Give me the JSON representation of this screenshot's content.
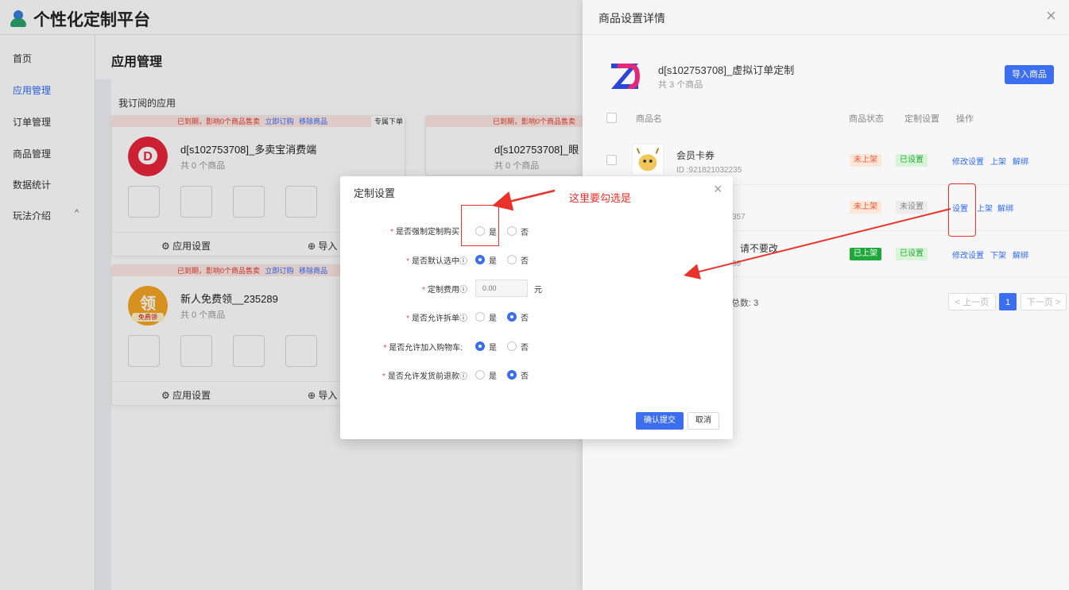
{
  "app": {
    "title": "个性化定制平台"
  },
  "sidebar": {
    "items": [
      {
        "label": "首页"
      },
      {
        "label": "应用管理"
      },
      {
        "label": "订单管理"
      },
      {
        "label": "商品管理"
      },
      {
        "label": "数据统计"
      },
      {
        "label": "玩法介绍"
      }
    ],
    "active": "应用管理"
  },
  "main": {
    "page_title": "应用管理",
    "section_title": "我订阅的应用",
    "banner": {
      "text": "已到期，影响0个商品售卖",
      "renew": "立即订购",
      "remove": "移除商品",
      "tag": "专属下单"
    },
    "cards": [
      {
        "name": "d[s102753708]_多卖宝消费端",
        "count": "共 0 个商品",
        "settings": "应用设置",
        "import": "导入"
      },
      {
        "name": "d[s102753708]_眼",
        "count": "共 0 个商品"
      },
      {
        "name": "新人免费领__235289",
        "count": "共 0 个商品",
        "settings": "应用设置",
        "import": "导入",
        "logo_text": "领",
        "logo_sub": "免费领"
      }
    ]
  },
  "drawer": {
    "title": "商品设置详情",
    "close": "×",
    "shop_name": "d[s102753708]_虚拟订单定制",
    "shop_count": "共 3 个商品",
    "import_button": "导入商品",
    "columns": [
      "商品名",
      "商品状态",
      "定制设置",
      "操作"
    ],
    "rows": [
      {
        "name": "会员卡券",
        "id": "ID :921821032235",
        "status": "未上架",
        "custom": "已设置",
        "ops": [
          "修改设置",
          "上架",
          "解绑"
        ]
      },
      {
        "id_tail": "357",
        "status": "未上架",
        "custom": "未设置",
        "ops": [
          "设置",
          "上架",
          "解绑"
        ]
      },
      {
        "name": "请不要改",
        "id_tail": "96",
        "status": "已上架",
        "custom": "已设置",
        "ops": [
          "修改设置",
          "下架",
          "解绑"
        ]
      }
    ],
    "total": "总数: 3",
    "pagination": {
      "prev": "< 上一页",
      "current": "1",
      "next": "下一页 >"
    }
  },
  "modal": {
    "title": "定制设置",
    "close": "×",
    "fields": [
      {
        "label": "是否强制定制购买",
        "yes": "是",
        "no": "否",
        "selected": "none"
      },
      {
        "label": "是否默认选中ⓘ",
        "yes": "是",
        "no": "否",
        "selected": "yes"
      },
      {
        "label": "定制费用ⓘ",
        "value_placeholder": "0.00",
        "unit": "元"
      },
      {
        "label": "是否允许拆单ⓘ",
        "yes": "是",
        "no": "否",
        "selected": "no"
      },
      {
        "label": "是否允许加入购物车:",
        "yes": "是",
        "no": "否",
        "selected": "yes"
      },
      {
        "label": "是否允许发货前退款ⓘ",
        "yes": "是",
        "no": "否",
        "selected": "no"
      }
    ],
    "submit": "确认提交",
    "cancel": "取消"
  },
  "annotation": {
    "note": "这里要勾选是",
    "color": "#e8322a"
  },
  "colors": {
    "primary": "#3c6ef0",
    "danger": "#e8322a",
    "success": "#1fa83c"
  }
}
